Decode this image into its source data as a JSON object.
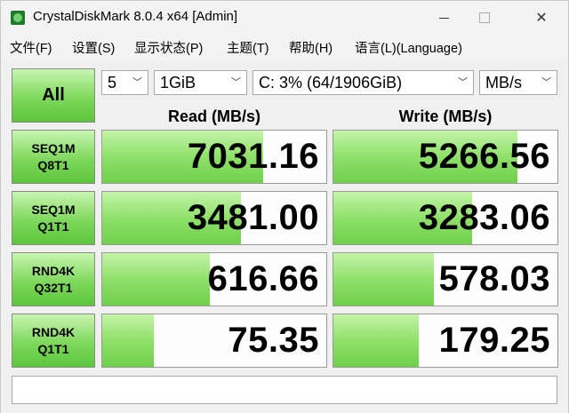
{
  "window": {
    "title": "CrystalDiskMark 8.0.4 x64 [Admin]",
    "minimize_symbol": "",
    "close_symbol": "✕"
  },
  "menu": [
    "文件(F)",
    "设置(S)",
    "显示状态(P)",
    "主题(T)",
    "帮助(H)",
    "语言(L)(Language)"
  ],
  "controls": {
    "all_label": "All",
    "count": "5",
    "size": "1GiB",
    "drive": "C: 3% (64/1906GiB)",
    "unit": "MB/s"
  },
  "headers": {
    "read": "Read (MB/s)",
    "write": "Write (MB/s)"
  },
  "tests": [
    {
      "line1": "SEQ1M",
      "line2": "Q8T1",
      "read": "7031.16",
      "write": "5266.56",
      "read_fill": 0.72,
      "write_fill": 0.82
    },
    {
      "line1": "SEQ1M",
      "line2": "Q1T1",
      "read": "3481.00",
      "write": "3283.06",
      "read_fill": 0.62,
      "write_fill": 0.62
    },
    {
      "line1": "RND4K",
      "line2": "Q32T1",
      "read": "616.66",
      "write": "578.03",
      "read_fill": 0.48,
      "write_fill": 0.45
    },
    {
      "line1": "RND4K",
      "line2": "Q1T1",
      "read": "75.35",
      "write": "179.25",
      "read_fill": 0.23,
      "write_fill": 0.38
    }
  ],
  "comment": ""
}
